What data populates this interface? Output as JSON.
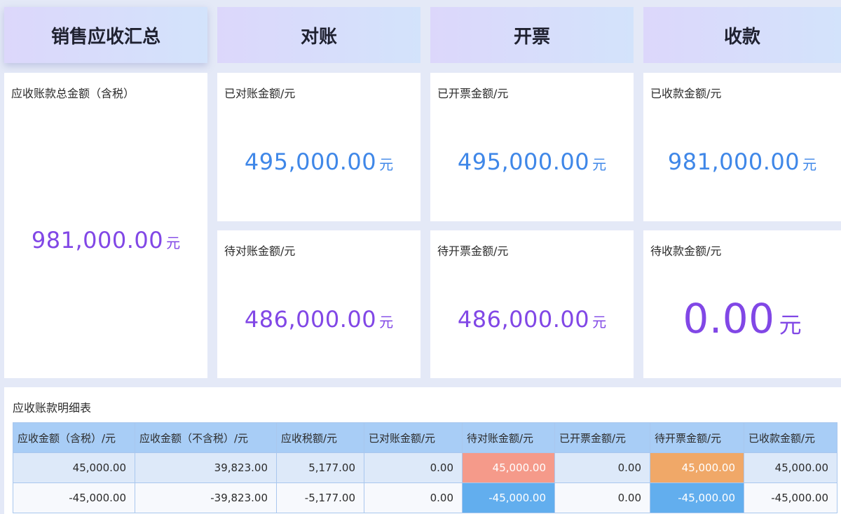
{
  "headers": {
    "summary": "销售应收汇总",
    "reconcile": "对账",
    "invoice": "开票",
    "collection": "收款"
  },
  "summary_card": {
    "label": "应收账款总金额（含税）",
    "value": "981,000.00",
    "unit": "元"
  },
  "reconciled_card": {
    "label": "已对账金额/元",
    "value": "495,000.00",
    "unit": "元"
  },
  "pending_reconcile_card": {
    "label": "待对账金额/元",
    "value": "486,000.00",
    "unit": "元"
  },
  "invoiced_card": {
    "label": "已开票金额/元",
    "value": "495,000.00",
    "unit": "元"
  },
  "pending_invoice_card": {
    "label": "待开票金额/元",
    "value": "486,000.00",
    "unit": "元"
  },
  "collected_card": {
    "label": "已收款金额/元",
    "value": "981,000.00",
    "unit": "元"
  },
  "pending_collection_card": {
    "label": "待收款金额/元",
    "value": "0.00",
    "unit": "元"
  },
  "detail": {
    "title": "应收账款明细表",
    "columns": [
      "应收金额（含税）/元",
      "应收金额（不含税）/元",
      "应收税额/元",
      "已对账金额/元",
      "待对账金额/元",
      "已开票金额/元",
      "待开票金额/元",
      "已收款金额/元"
    ],
    "rows": [
      [
        "45,000.00",
        "39,823.00",
        "5,177.00",
        "0.00",
        "45,000.00",
        "0.00",
        "45,000.00",
        "45,000.00"
      ],
      [
        "-45,000.00",
        "-39,823.00",
        "-5,177.00",
        "0.00",
        "-45,000.00",
        "0.00",
        "-45,000.00",
        "-45,000.00"
      ]
    ]
  },
  "colors": {
    "value_blue": "#3f87e8",
    "value_purple": "#8147e6",
    "cell_red": "#f59a8a",
    "cell_orange": "#f0a868",
    "cell_blue": "#62aeee"
  }
}
